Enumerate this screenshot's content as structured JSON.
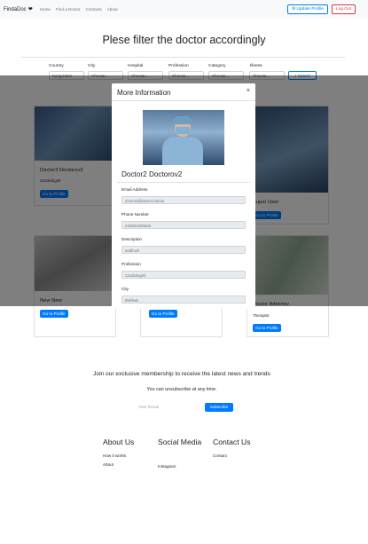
{
  "navbar": {
    "brand": "FindaDoc",
    "links": [
      "Home",
      "Find a Doctor",
      "Contacts",
      "About"
    ],
    "update_profile": "Update Profile",
    "logout": "Log Out"
  },
  "headline": "Plese filter the doctor accordingly",
  "filter": {
    "labels": [
      "Country",
      "City",
      "Hospital",
      "Profession",
      "Category",
      "Illness"
    ],
    "selects": [
      "Kyrgyzstan",
      "Choose...",
      "Choose...",
      "Choose...",
      "Choose...",
      "Choose..."
    ],
    "search_label": "Search"
  },
  "cards": [
    {
      "name": "Doctor3 Doctorov3",
      "spec": "Cardiologist",
      "button": "Go to Profile"
    },
    {
      "name": "Super User",
      "spec": "",
      "button": "Go to Profile"
    },
    {
      "name": "New New",
      "spec": "",
      "button": "Go to Profile"
    },
    {
      "name": "",
      "spec": "",
      "button": "Go to Profile"
    },
    {
      "name": "Doctor Adminov",
      "spec": "Therapist",
      "button": "Go to Profile"
    }
  ],
  "modal": {
    "title": "More Information",
    "close": "×",
    "doctor_name": "Doctor2 Doctorov2",
    "fields": [
      {
        "label": "Email Address",
        "value": "doctor2@doctor.doctor"
      },
      {
        "label": "Phone Number",
        "value": "234802290845"
      },
      {
        "label": "Description",
        "value": "asdfcwh"
      },
      {
        "label": "Profession",
        "value": "Cardiologist"
      },
      {
        "label": "City",
        "value": "Bishkek"
      }
    ]
  },
  "newsletter": {
    "title": "Join our exclusive membership to receive the latest news and trends",
    "subtitle": "You can unsubscribe at any time.",
    "email_placeholder": "Your Email",
    "subscribe": "Subscribe"
  },
  "footer": {
    "about": {
      "title": "About Us",
      "links": [
        "How it works",
        "About"
      ]
    },
    "social": {
      "title": "Social Media",
      "links": [
        "Instagram"
      ]
    },
    "contact": {
      "title": "Contact Us",
      "links": [
        "Contact"
      ]
    }
  }
}
